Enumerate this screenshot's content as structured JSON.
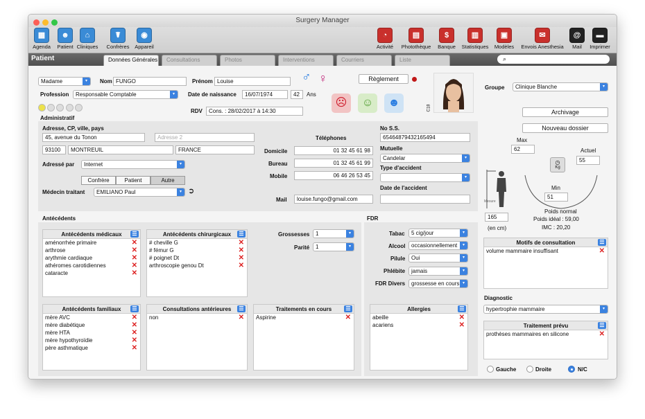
{
  "app": {
    "title": "Surgery Manager"
  },
  "toolbar_left": [
    {
      "id": "agenda",
      "label": "Agenda",
      "icon": "agenda-icon",
      "color": "#3a8bd6",
      "glyph": "▦"
    },
    {
      "id": "patient",
      "label": "Patient",
      "icon": "patient-icon",
      "color": "#3a8bd6",
      "glyph": "☻"
    },
    {
      "id": "cliniques",
      "label": "Cliniques",
      "icon": "clinic-icon",
      "color": "#3a8bd6",
      "glyph": "⌂"
    },
    {
      "id": "confreres",
      "label": "Confrères",
      "icon": "colleagues-icon",
      "color": "#3a8bd6",
      "glyph": "☤"
    },
    {
      "id": "appareil",
      "label": "Appareil",
      "icon": "camera-icon",
      "color": "#3a8bd6",
      "glyph": "◉"
    }
  ],
  "toolbar_right": [
    {
      "id": "activite",
      "label": "Activité",
      "icon": "gauge-icon",
      "color": "#c9302c",
      "glyph": "◔"
    },
    {
      "id": "phototheque",
      "label": "Photothèque",
      "icon": "photo-library-icon",
      "color": "#c9302c",
      "glyph": "▤"
    },
    {
      "id": "banque",
      "label": "Banque",
      "icon": "bank-icon",
      "color": "#c9302c",
      "glyph": "$"
    },
    {
      "id": "statistiques",
      "label": "Statistiques",
      "icon": "statistics-icon",
      "color": "#c9302c",
      "glyph": "▥"
    },
    {
      "id": "modeles",
      "label": "Modèles",
      "icon": "templates-icon",
      "color": "#c9302c",
      "glyph": "▣"
    },
    {
      "id": "envois",
      "label": "Envois Anesthesia",
      "icon": "send-icon",
      "color": "#c9302c",
      "glyph": "✉"
    },
    {
      "id": "mail",
      "label": "Mail",
      "icon": "at-icon",
      "color": "#222222",
      "glyph": "@"
    },
    {
      "id": "imprimer",
      "label": "Imprimer",
      "icon": "printer-icon",
      "color": "#222222",
      "glyph": "▬"
    }
  ],
  "section_title": "Patient",
  "tabs": [
    "Données Générales",
    "Consultations",
    "Photos",
    "Interventions",
    "Courriers",
    "Liste"
  ],
  "search_icon": "search-icon",
  "identity": {
    "civility": "Madame",
    "nom_label": "Nom",
    "nom": "FUNGO",
    "prenom_label": "Prénom",
    "prenom": "Louise",
    "profession_label": "Profession",
    "profession": "Responsable Comptable",
    "dob_label": "Date de naissance",
    "dob": "16/07/1974",
    "age": "42",
    "age_unit": "Ans",
    "rdv_label": "RDV",
    "rdv": "Cons. : 28/02/2017 à 14:30",
    "reglement": "Règlement",
    "male_symbol": "♂",
    "female_symbol": "♀",
    "admin_label": "Administratif",
    "photo_code": "C18"
  },
  "address": {
    "header": "Adresse, CP, ville, pays",
    "line1": "45, avenue du Tonon",
    "line2_placeholder": "Adresse 2",
    "cp": "93100",
    "city": "MONTREUIL",
    "country": "FRANCE",
    "adresse_par_label": "Adressé par",
    "adresse_par": "Internet",
    "seg": [
      "Confrère",
      "Patient",
      "Autre"
    ],
    "medecin_label": "Médecin traitant",
    "medecin": "EMILIANO Paul"
  },
  "phones": {
    "header": "Téléphones",
    "domicile_label": "Domicile",
    "domicile": "01 32 45 61 98",
    "bureau_label": "Bureau",
    "bureau": "01 32 45 61 99",
    "mobile_label": "Mobile",
    "mobile": "06 46 26 53 45",
    "mail_label": "Mail",
    "mail": "louise.fungo@gmail.com"
  },
  "secu": {
    "nss_label": "No S.S.",
    "nss": "65464879432165494",
    "mutuelle_label": "Mutuelle",
    "mutuelle": "Candelar",
    "accident_label": "Type d'accident",
    "date_accident_label": "Date de l'accident"
  },
  "right": {
    "groupe_label": "Groupe",
    "groupe": "Clinique Blanche",
    "archivage": "Archivage",
    "nouveau": "Nouveau dossier",
    "max_label": "Max",
    "max": "62",
    "actuel_label": "Actuel",
    "actuel": "55",
    "min_label": "Min",
    "min": "51",
    "kg": "Kg",
    "taille": "165",
    "taille_unit": "(en cm)",
    "mesure": "Mesure",
    "poids_normal": "Poids normal",
    "poids_ideal": "Poids idéal : 59,00",
    "imc": "IMC : 20,20",
    "motifs_header": "Motifs de consultation",
    "motifs": [
      "volume mammaire insuffisant"
    ],
    "diagnostic_label": "Diagnostic",
    "diagnostic": "hypertrophie mammaire",
    "traitement_header": "Traitement prévu",
    "traitement": [
      "prothèses mammaires en silicone"
    ],
    "sides": [
      "Gauche",
      "Droite",
      "N/C"
    ]
  },
  "antecedents": {
    "header": "Antécédents",
    "medicaux": {
      "title": "Antécédents médicaux",
      "items": [
        "aménorrhée primaire",
        "arthrose",
        "arythmie cardiaque",
        "athéromes carotidiennes",
        "cataracte"
      ]
    },
    "chirurgicaux": {
      "title": "Antécédents chirurgicaux",
      "items": [
        "# cheville G",
        "# fémur G",
        "# poignet Dt",
        "arthroscopie genou Dt"
      ]
    },
    "familiaux": {
      "title": "Antécédents familiaux",
      "items": [
        "mère AVC",
        "mère diabétique",
        "mère HTA",
        "mère hypothyroïdie",
        "père asthmatique"
      ]
    },
    "consultations": {
      "title": "Consultations antérieures",
      "items": [
        "non"
      ]
    },
    "traitements": {
      "title": "Traitements en cours",
      "items": [
        "Aspirine"
      ]
    },
    "grossesses_label": "Grossesses",
    "grossesses": "1",
    "parite_label": "Parité",
    "parite": "1"
  },
  "fdr": {
    "header": "FDR",
    "tabac_label": "Tabac",
    "tabac": "5 cig/jour",
    "alcool_label": "Alcool",
    "alcool": "occasionnellement",
    "pilule_label": "Pilule",
    "pilule": "Oui",
    "phlebite_label": "Phlébite",
    "phlebite": "jamais",
    "divers_label": "FDR Divers",
    "divers": "grossesse en cours",
    "allergies": {
      "title": "Allergies",
      "items": [
        "abeille",
        "acariens"
      ]
    }
  }
}
